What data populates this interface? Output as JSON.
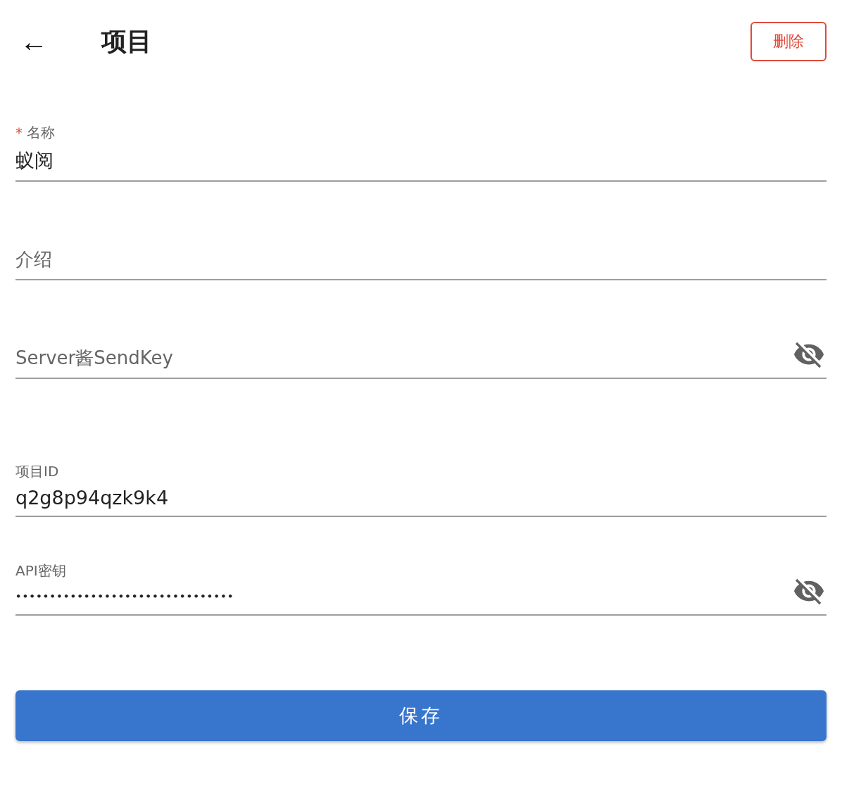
{
  "header": {
    "back_icon": "←",
    "title": "项目",
    "delete_button": "删除"
  },
  "fields": [
    {
      "label": "名称",
      "required_mark": "*",
      "value": "蚁阅",
      "visibility_toggle": false,
      "group_gap": false
    },
    {
      "label": "介绍",
      "visibility_toggle": false,
      "group_gap": false
    },
    {
      "label": "Server酱SendKey",
      "visibility_toggle": true,
      "group_gap": false
    },
    {
      "label": "项目ID",
      "value": "q2g8p94qzk9k4",
      "visibility_toggle": false,
      "group_gap": true
    },
    {
      "label": "API密钥",
      "value": "••••••••••••••••••••••••••••••••",
      "visibility_toggle": true,
      "group_gap": false
    }
  ],
  "save_button": "保存"
}
